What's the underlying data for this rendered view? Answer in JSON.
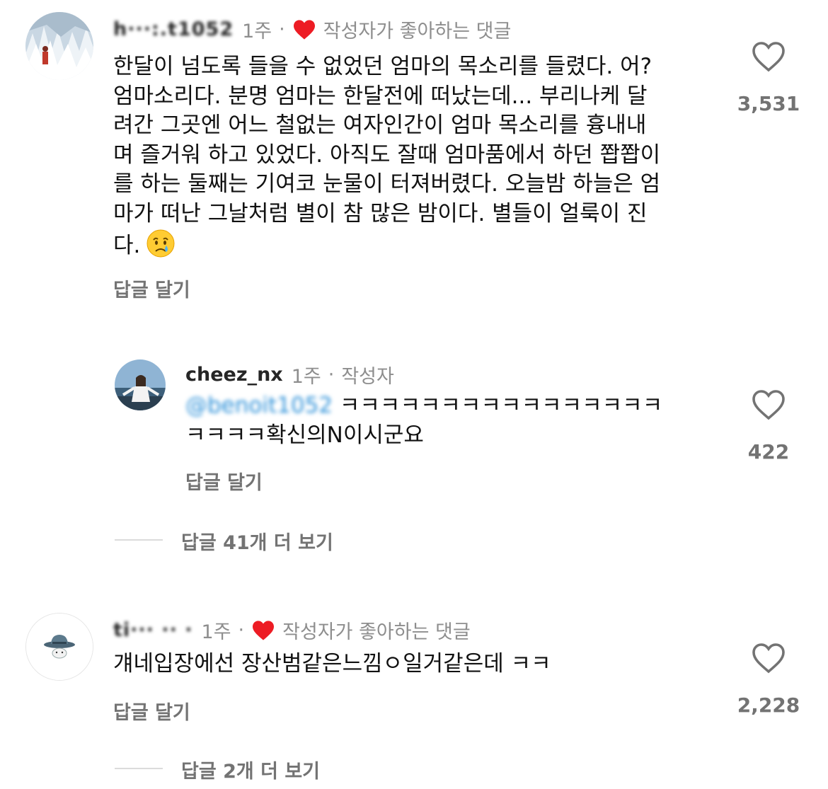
{
  "comments": [
    {
      "username": "h···:.t1052",
      "time": "1주",
      "author_liked_text": "작성자가 좋아하는 댓글",
      "body": "한달이 넘도록 들을 수 없었던 엄마의 목소리를 들렸다. 어?\n엄마소리다. 분명 엄마는 한달전에 떠났는데... 부리나케 달\n려간 그곳엔 어느 철없는 여자인간이 엄마 목소리를 흉내내\n며 즐거워 하고 있었다. 아직도 잘때 엄마품에서 하던 쫩쫩이\n를 하는 둘째는 기여코 눈물이 터져버렸다. 오늘밤 하늘은 엄\n마가 떠난 그날처럼 별이 참 많은 밤이다. 별들이 얼룩이 진\n다.",
      "emoji": "crying-face",
      "reply_label": "답글 달기",
      "like_count": "3,531"
    },
    {
      "username": "cheez_nx",
      "time": "1주",
      "author_badge": "작성자",
      "mention": "@benoit1052",
      "body_line1": "ㅋㅋㅋㅋㅋㅋㅋㅋㅋㅋㅋㅋㅋㅋㅋㅋ",
      "body_line2": "ㅋㅋㅋㅋ확신의N이시군요",
      "reply_label": "답글 달기",
      "like_count": "422"
    },
    {
      "username": "ti··· ·· ·",
      "time": "1주",
      "author_liked_text": "작성자가 좋아하는 댓글",
      "body": "걔네입장에선 장산범같은느낌ㅇ일거같은데 ㅋㅋ",
      "reply_label": "답글 달기",
      "like_count": "2,228"
    }
  ],
  "view_more_1": "답글 41개 더 보기",
  "view_more_2": "답글 2개 더 보기",
  "colors": {
    "heart_red": "#ed1c24",
    "meta_gray": "#8e8e8e",
    "mention_blue": "#2a8fd8"
  }
}
